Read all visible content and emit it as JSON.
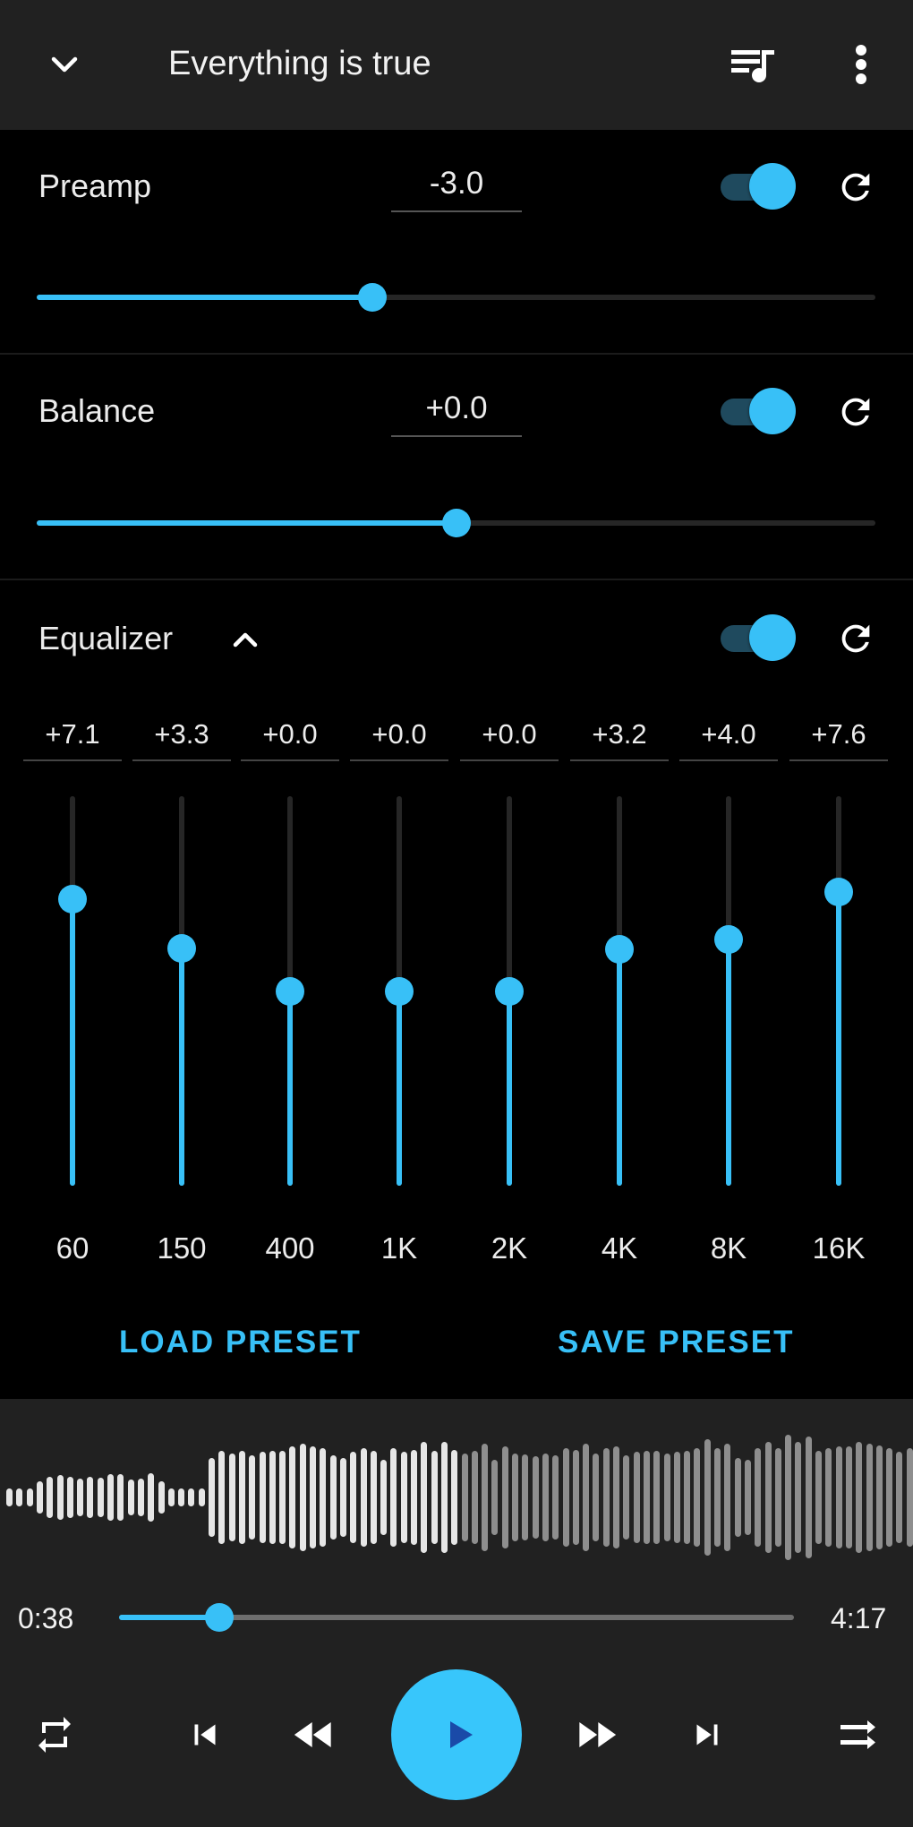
{
  "header": {
    "title": "Everything is true",
    "icons": {
      "collapse": "chevron-down-icon",
      "queue": "queue-music-icon",
      "menu": "more-vert-icon"
    }
  },
  "preamp": {
    "label": "Preamp",
    "value": "-3.0",
    "enabled": true,
    "min": -15,
    "max": 15,
    "level": -3.0
  },
  "balance": {
    "label": "Balance",
    "value": "+0.0",
    "enabled": true,
    "min": -15,
    "max": 15,
    "level": 0.0
  },
  "equalizer": {
    "label": "Equalizer",
    "expanded": true,
    "enabled": true,
    "min": -15,
    "max": 15,
    "bands": [
      {
        "freq": "60",
        "value": "+7.1",
        "level": 7.1
      },
      {
        "freq": "150",
        "value": "+3.3",
        "level": 3.3
      },
      {
        "freq": "400",
        "value": "+0.0",
        "level": 0.0
      },
      {
        "freq": "1K",
        "value": "+0.0",
        "level": 0.0
      },
      {
        "freq": "2K",
        "value": "+0.0",
        "level": 0.0
      },
      {
        "freq": "4K",
        "value": "+3.2",
        "level": 3.2
      },
      {
        "freq": "8K",
        "value": "+4.0",
        "level": 4.0
      },
      {
        "freq": "16K",
        "value": "+7.6",
        "level": 7.6
      }
    ],
    "load_preset": "LOAD PRESET",
    "save_preset": "SAVE PRESET"
  },
  "player": {
    "elapsed": "0:38",
    "duration": "4:17",
    "progress": 0.148,
    "waveform_levels": [
      0.2,
      0.2,
      0.2,
      0.35,
      0.45,
      0.48,
      0.45,
      0.4,
      0.45,
      0.42,
      0.5,
      0.5,
      0.38,
      0.4,
      0.52,
      0.35,
      0.2,
      0.2,
      0.2,
      0.2,
      0.85,
      1.0,
      0.95,
      1.0,
      0.9,
      0.98,
      1.0,
      1.0,
      1.1,
      1.15,
      1.1,
      1.05,
      0.9,
      0.85,
      0.98,
      1.05,
      1.0,
      0.8,
      1.05,
      0.98,
      1.02,
      1.2,
      1.0,
      1.2,
      1.02,
      0.95,
      1.0,
      1.15,
      0.8,
      1.1,
      0.95,
      0.92,
      0.88,
      0.95,
      0.9,
      1.05,
      1.02,
      1.15,
      0.95,
      1.05,
      1.1,
      0.9,
      0.98,
      1.0,
      1.0,
      0.95,
      0.98,
      1.0,
      1.05,
      1.25,
      1.05,
      1.15,
      0.85,
      0.8,
      1.05,
      1.2,
      1.05,
      1.35,
      1.2,
      1.3,
      1.0,
      1.05,
      1.1,
      1.1,
      1.2,
      1.15,
      1.12,
      1.05,
      0.98,
      1.05
    ],
    "controls": [
      "repeat-icon",
      "skip-previous-icon",
      "fast-rewind-icon",
      "play-icon",
      "fast-forward-icon",
      "skip-next-icon",
      "shuffle-icon"
    ]
  },
  "colors": {
    "accent": "#38c0f7",
    "header_bg": "#212121",
    "play_icon": "#1a4aa8"
  }
}
